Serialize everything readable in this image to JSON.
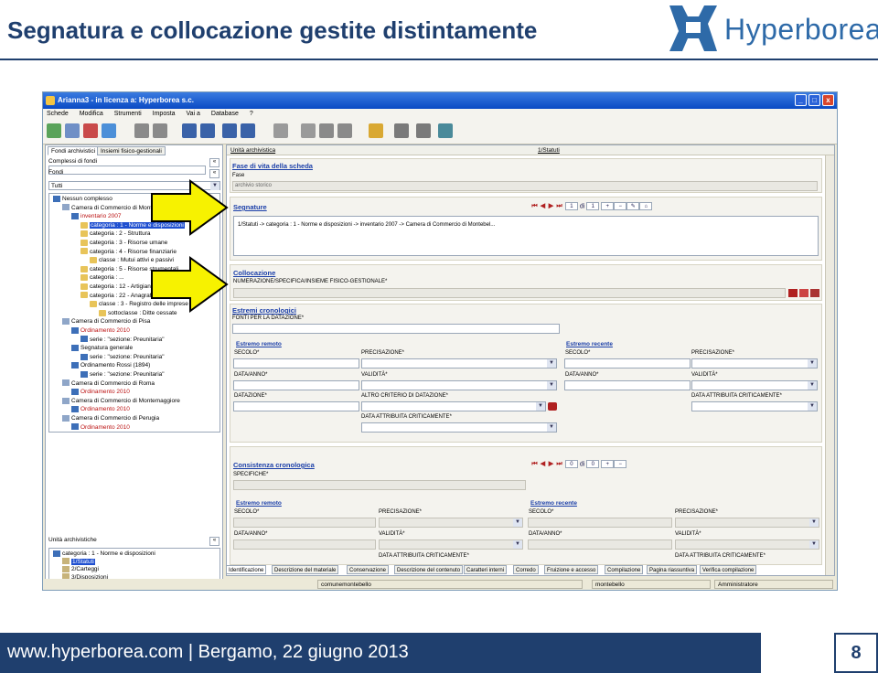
{
  "slide": {
    "title": "Segnatura e collocazione gestite distintamente",
    "logo_text": "Hyperborea",
    "footer": "www.hyperborea.com | Bergamo, 22 giugno 2013",
    "page_number": "8"
  },
  "window": {
    "title": "Arianna3 - in licenza a: Hyperborea s.c.",
    "buttons": [
      "_",
      "□",
      "x"
    ],
    "menu": [
      "Schede",
      "Modifica",
      "Strumenti",
      "Imposta",
      "Vai a",
      "Database",
      "?"
    ]
  },
  "left": {
    "tabs": [
      "Fondi archivistici",
      "Insiemi fisico-gestionali"
    ],
    "complessi_label": "Complessi di fondi",
    "fondi_label": "Fondi",
    "filter_value": "Tutti",
    "tree": [
      {
        "text": "Nessun complesso",
        "icon": "tree",
        "indent": 0
      },
      {
        "text": "Camera di Commercio di Monte...",
        "icon": "bldg",
        "indent": 1
      },
      {
        "text": "inventario 2007",
        "icon": "tree",
        "indent": 2,
        "red": true
      },
      {
        "text": "categoria : 1 - Norme e disposizioni",
        "icon": "folder",
        "indent": 3,
        "selected": true
      },
      {
        "text": "categoria : 2 - Struttura",
        "icon": "folder",
        "indent": 3
      },
      {
        "text": "categoria : 3 - Risorse umane",
        "icon": "folder",
        "indent": 3
      },
      {
        "text": "categoria : 4 - Risorse finanziarie",
        "icon": "folder",
        "indent": 3
      },
      {
        "text": "classe : Mutui attivi e passivi",
        "icon": "folder",
        "indent": 4
      },
      {
        "text": "categoria : 5 - Risorse strumentali",
        "icon": "folder",
        "indent": 3
      },
      {
        "text": "categoria : ...",
        "icon": "folder",
        "indent": 3
      },
      {
        "text": "categoria : 12 - Artigianato",
        "icon": "folder",
        "indent": 3
      },
      {
        "text": "categoria : 22 - Anagrafe",
        "icon": "folder",
        "indent": 3
      },
      {
        "text": "classe : 3 - Registro delle imprese",
        "icon": "folder",
        "indent": 4
      },
      {
        "text": "sottoclasse : Ditte cessate",
        "icon": "folder",
        "indent": 5
      },
      {
        "text": "Camera di Commercio di Pisa",
        "icon": "bldg",
        "indent": 1
      },
      {
        "text": "Ordinamento 2010",
        "icon": "tree",
        "indent": 2,
        "red": true
      },
      {
        "text": "serie : \"sezione: Preunitaria\"",
        "icon": "tree",
        "indent": 3
      },
      {
        "text": "Segnatura generale",
        "icon": "tree",
        "indent": 2
      },
      {
        "text": "serie : \"sezione: Preunitaria\"",
        "icon": "tree",
        "indent": 3
      },
      {
        "text": "Ordinamento Rossi (1894)",
        "icon": "tree",
        "indent": 2
      },
      {
        "text": "serie : \"sezione: Preunitaria\"",
        "icon": "tree",
        "indent": 3
      },
      {
        "text": "Camera di Commercio di Roma",
        "icon": "bldg",
        "indent": 1
      },
      {
        "text": "Ordinamento 2010",
        "icon": "tree",
        "indent": 2,
        "red": true
      },
      {
        "text": "Camera di Commercio di Montemaggiore",
        "icon": "bldg",
        "indent": 1
      },
      {
        "text": "Ordinamento 2010",
        "icon": "tree",
        "indent": 2,
        "red": true
      },
      {
        "text": "Camera di Commercio di Perugia",
        "icon": "bldg",
        "indent": 1
      },
      {
        "text": "Ordinamento 2010",
        "icon": "tree",
        "indent": 2,
        "red": true
      }
    ],
    "unita_label": "Unità archivistiche",
    "unita_tree": [
      {
        "text": "categoria : 1 - Norme e disposizioni",
        "indent": 0
      },
      {
        "text": "1/Statuti",
        "indent": 1,
        "selected": true
      },
      {
        "text": "2/Carteggi",
        "indent": 1
      },
      {
        "text": "3/Disposizioni",
        "indent": 1
      }
    ]
  },
  "right": {
    "header_left": "Unità archivistica",
    "header_right": "1/Statuti",
    "fase": {
      "title": "Fase di vita della scheda",
      "value": "archivio storico"
    },
    "segnature": {
      "title": "Segnature",
      "path": "1/Statuti -> categoria : 1 - Norme e disposizioni -> inventario 2007 -> Camera di Commercio di Montebel...",
      "nav_index": "1",
      "nav_of": "di",
      "nav_total": "1"
    },
    "collocazione": {
      "title": "Collocazione",
      "label": "NUMERAZIONE/SPECIFICA/INSIEME FISICO-GESTIONALE*"
    },
    "estremi": {
      "title": "Estremi cronologici",
      "fonti_label": "FONTI PER LA DATAZIONE*",
      "remoto": "Estremo remoto",
      "recente": "Estremo recente",
      "secolo": "SECOLO*",
      "precisazione": "PRECISAZIONE*",
      "data_anno": "DATA/ANNO*",
      "validita": "VALIDITÀ*",
      "datazione": "DATAZIONE*",
      "altro_criterio": "ALTRO CRITERIO DI DATAZIONE*",
      "data_attributa": "DATA ATTRIBUITA CRITICAMENTE*"
    },
    "consistenza": {
      "title": "Consistenza cronologica",
      "specifiche": "SPECIFICHE*",
      "nav_index": "0",
      "nav_of": "di",
      "nav_total": "0"
    },
    "bottom_tabs": [
      "Identificazione",
      "Descrizione del materiale",
      "Conservazione",
      "Descrizione del contenuto",
      "Caratteri interni",
      "Corredo",
      "Fruizione e accesso",
      "Compilazione",
      "Pagina riassuntiva",
      "Verifica compilazione"
    ]
  },
  "status": {
    "user": "comunemontebello",
    "db": "montebello",
    "role": "Amministratore"
  },
  "colors": {
    "slide_title": "#1f3f6e",
    "arrow_fill": "#f7f200",
    "link_blue": "#1a3ea8",
    "footer_bg": "#1f3f6e"
  }
}
